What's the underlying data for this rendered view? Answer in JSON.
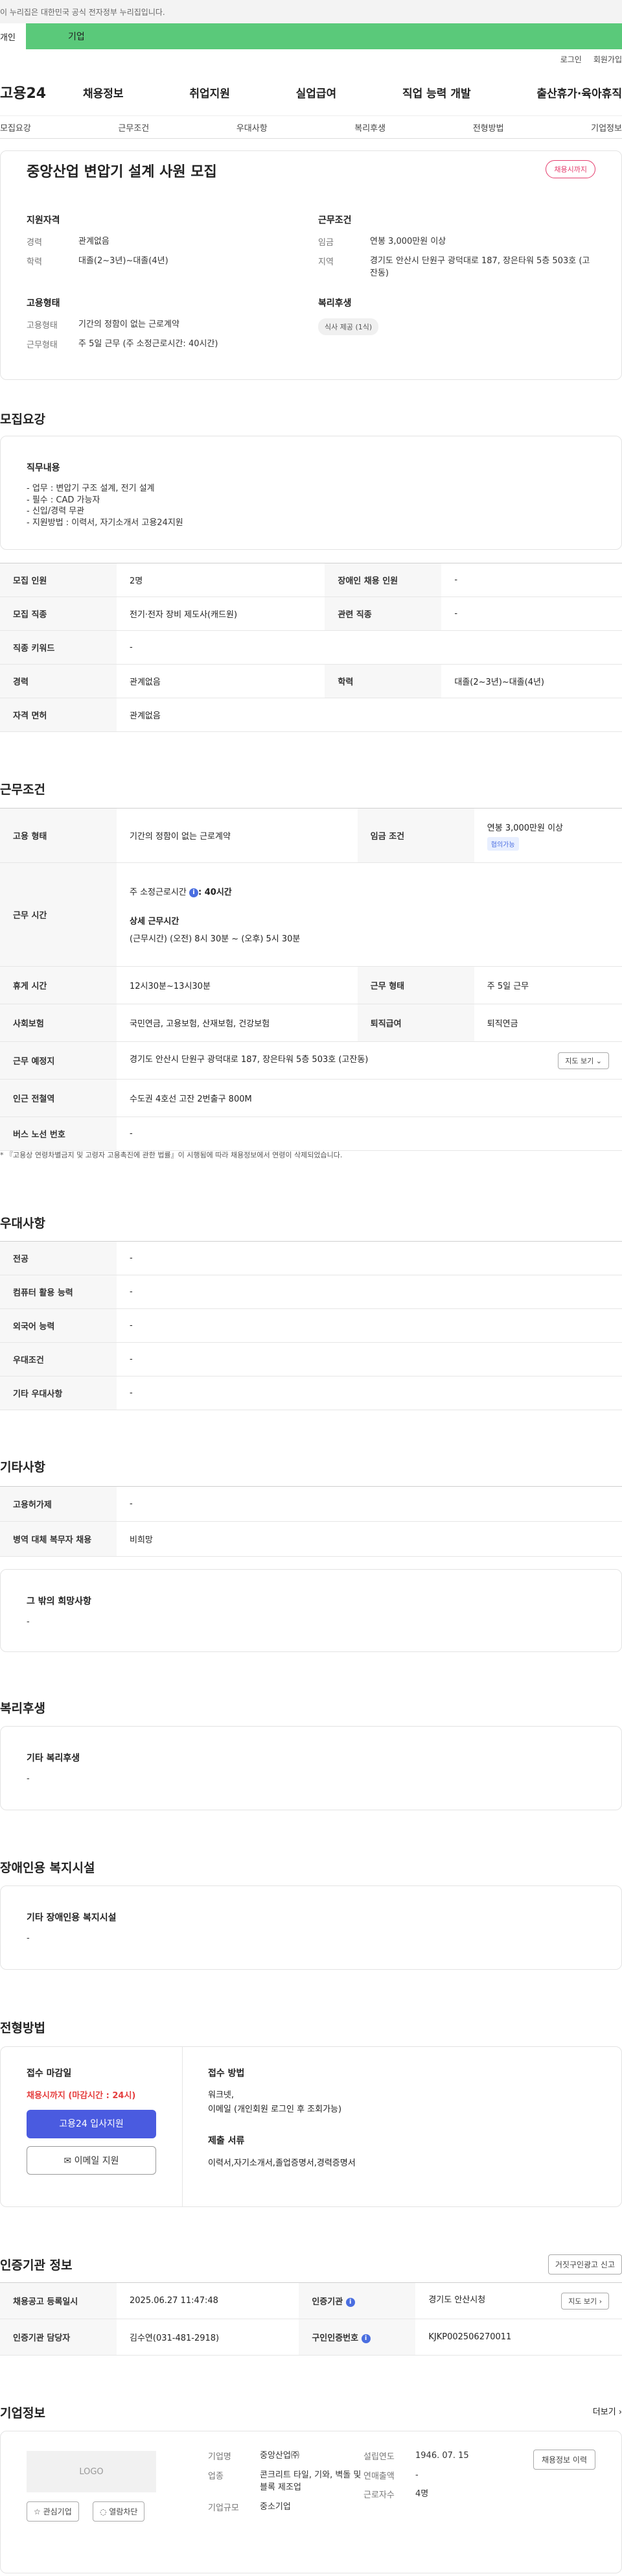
{
  "gov_banner": "이 누리집은 대한민국 공식 전자정부 누리집입니다.",
  "mode": {
    "left": "개인",
    "right": "기업"
  },
  "util": {
    "login": "로그인",
    "join": "회원가입"
  },
  "logo": "고용24",
  "gnb": [
    "채용정보",
    "취업지원",
    "실업급여",
    "직업 능력 개발",
    "출산휴가·육아휴직"
  ],
  "subnav": [
    "모집요강",
    "근무조건",
    "우대사항",
    "복리후생",
    "전형방법",
    "기업정보"
  ],
  "summary": {
    "title": "중앙산업 변압기 설계 사원 모집",
    "badge": "채용시까지",
    "qual_title": "지원자격",
    "qual": [
      {
        "k": "경력",
        "v": "관계없음"
      },
      {
        "k": "학력",
        "v": "대졸(2~3년)~대졸(4년)"
      }
    ],
    "work_title": "근무조건",
    "work": [
      {
        "k": "임금",
        "v": "연봉 3,000만원 이상"
      },
      {
        "k": "지역",
        "v": "경기도 안산시 단원구 광덕대로 187, 장은타워 5층 503호 (고잔동)"
      }
    ],
    "emp_title": "고용형태",
    "emp": [
      {
        "k": "고용형태",
        "v": "기간의 정함이 없는 근로계약"
      },
      {
        "k": "근무형태",
        "v": "주 5일 근무 (주 소정근로시간: 40시간)"
      }
    ],
    "welfare_title": "복리후생",
    "welfare_chip": "식사 제공 (1식)"
  },
  "recruit": {
    "heading": "모집요강",
    "duty_title": "직무내용",
    "duty_lines": [
      "- 업무 : 변압기 구조 설계, 전기 설계",
      "- 필수 : CAD 가능자",
      "- 신입/경력 무관",
      "- 지원방법 : 이력서, 자기소개서 고용24지원"
    ],
    "rows": [
      {
        "k1": "모집 인원",
        "v1": "2명",
        "k2": "장애인 채용 인원",
        "v2": "-"
      },
      {
        "k1": "모집 직종",
        "v1": "전기·전자 장비 제도사(캐드원)",
        "k2": "관련 직종",
        "v2": "-"
      },
      {
        "k1": "직종 키워드",
        "v1": "-"
      },
      {
        "k1": "경력",
        "v1": "관계없음",
        "k2": "학력",
        "v2": "대졸(2~3년)~대졸(4년)"
      },
      {
        "k1": "자격 면허",
        "v1": "관계없음"
      }
    ]
  },
  "work": {
    "heading": "근무조건",
    "emp_type_k": "고용 형태",
    "emp_type_v": "기간의 정함이 없는 근로계약",
    "wage_k": "임금 조건",
    "wage_v": "연봉 3,000만원 이상",
    "wage_badge": "협의가능",
    "hours_k": "근무 시간",
    "hours_main": "주 소정근로시간 ",
    "hours_main_bold": ": 40시간",
    "hours_detail_t": "상세 근무시간",
    "hours_detail_v": "(근무시간) (오전) 8시 30분 ~ (오후) 5시 30분",
    "break_k": "휴게 시간",
    "break_v": "12시30분~13시30분",
    "worktype_k": "근무 형태",
    "worktype_v": "주 5일 근무",
    "ins_k": "사회보험",
    "ins_v": "국민연금, 고용보험, 산재보험, 건강보험",
    "sev_k": "퇴직급여",
    "sev_v": "퇴직연금",
    "loc_k": "근무 예정지",
    "loc_v": "경기도 안산시 단원구 광덕대로 187, 장은타워 5층 503호 (고잔동)",
    "map_btn": "지도 보기 ⌄",
    "sub_k": "인근 전철역",
    "sub_v": "수도권 4호선 고잔 2번출구 800M",
    "bus_k": "버스 노선 번호",
    "bus_v": "-",
    "note": "* 『고용상 연령차별금지 및 고령자 고용촉진에 관한 법률』이 시행됨에 따라 채용정보에서 연령이 삭제되었습니다."
  },
  "pref": {
    "heading": "우대사항",
    "rows": [
      {
        "k": "전공",
        "v": "-"
      },
      {
        "k": "컴퓨터 활용 능력",
        "v": "-"
      },
      {
        "k": "외국어 능력",
        "v": "-"
      },
      {
        "k": "우대조건",
        "v": "-"
      },
      {
        "k": "기타 우대사항",
        "v": "-"
      }
    ]
  },
  "etc": {
    "heading": "기타사항",
    "rows": [
      {
        "k": "고용허가제",
        "v": "-"
      },
      {
        "k": "병역 대체 복무자 채용",
        "v": "비희망"
      }
    ],
    "box_title": "그 밖의 희망사항",
    "box_value": "-"
  },
  "welfare": {
    "heading": "복리후생",
    "box_title": "기타 복리후생",
    "box_value": "-"
  },
  "disability": {
    "heading": "장애인용 복지시설",
    "box_title": "기타 장애인용 복지시설",
    "box_value": "-"
  },
  "process": {
    "heading": "전형방법",
    "deadline_t": "접수 마감일",
    "deadline_v": "채용시까지 (마감시간 : 24시)",
    "apply_btn": "고용24 입사지원",
    "email_btn": "✉ 이메일 지원",
    "method_t": "접수 방법",
    "method_lines": [
      "워크넷,",
      "이메일 (개인회원 로그인 후 조회가능)"
    ],
    "docs_t": "제출 서류",
    "docs_v": "이력서,자기소개서,졸업증명서,경력증명서"
  },
  "agency": {
    "heading": "인증기관 정보",
    "report_btn": "거짓구인광고 신고",
    "reg_k": "채용공고 등록일시",
    "reg_v": "2025.06.27 11:47:48",
    "org_k": "인증기관",
    "org_v": "경기도 안산시청",
    "map_btn": "지도 보기 ›",
    "mgr_k": "인증기관 담당자",
    "mgr_v": "김수연(031-481-2918)",
    "num_k": "구인인증번호",
    "num_v": "KJKP002506270011"
  },
  "company": {
    "heading": "기업정보",
    "more": "더보기 ›",
    "logo": "LOGO",
    "fav_btn": "☆ 관심기업",
    "block_btn": "◌ 열람차단",
    "name_k": "기업명",
    "name_v": "중앙산업㈜",
    "ind_k": "업종",
    "ind_v": "콘크리트 타일, 기와, 벽돌 및 블록 제조업",
    "size_k": "기업규모",
    "size_v": "중소기업",
    "est_k": "설립연도",
    "est_v": "1946. 07. 15",
    "sales_k": "연매출액",
    "sales_v": "-",
    "emp_k": "근로자수",
    "emp_v": "4명",
    "history_btn": "채용정보 이력"
  }
}
